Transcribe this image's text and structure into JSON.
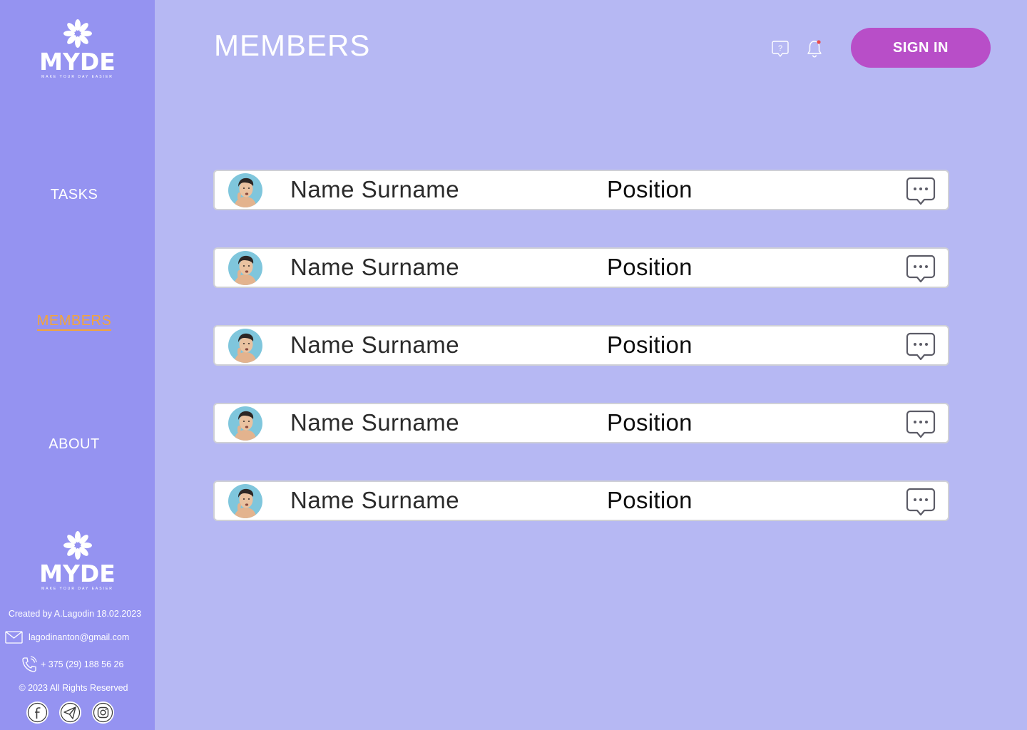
{
  "brand": {
    "name": "MYDE",
    "tagline": "MAKE YOUR DAY EASIER"
  },
  "nav": {
    "items": [
      {
        "label": "TASKS",
        "active": false
      },
      {
        "label": "MEMBERS",
        "active": true
      },
      {
        "label": "ABOUT",
        "active": false
      }
    ]
  },
  "footer": {
    "created": "Created by A.Lagodin 18.02.2023",
    "email": "lagodinanton@gmail.com",
    "phone": "+ 375 (29) 188 56 26",
    "copyright": "© 2023 All Rights Reserved",
    "socials": [
      "facebook-icon",
      "telegram-icon",
      "instagram-icon"
    ]
  },
  "header": {
    "title": "MEMBERS",
    "help_icon": "help-chat-icon",
    "bell_icon": "bell-icon",
    "signin_label": "SIGN IN"
  },
  "members": [
    {
      "name": "Name Surname",
      "position": "Position"
    },
    {
      "name": "Name Surname",
      "position": "Position"
    },
    {
      "name": "Name Surname",
      "position": "Position"
    },
    {
      "name": "Name Surname",
      "position": "Position"
    },
    {
      "name": "Name Surname",
      "position": "Position"
    }
  ],
  "colors": {
    "sidebar": "#9593f1",
    "background": "#b6b8f3",
    "accent": "#b84ec8",
    "active_nav": "#f3a43b",
    "notification_dot": "#e94b4b"
  }
}
